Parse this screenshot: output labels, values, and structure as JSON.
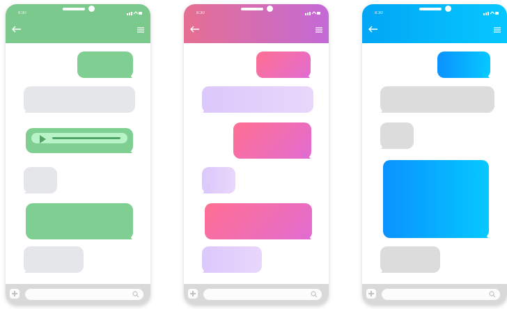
{
  "phones": [
    {
      "id": "green",
      "status_time": "8:30",
      "icons": [
        "back-arrow-icon",
        "menu-icon",
        "plus-icon",
        "search-icon"
      ]
    },
    {
      "id": "pink",
      "status_time": "8:30",
      "icons": [
        "back-arrow-icon",
        "menu-icon",
        "plus-icon",
        "search-icon"
      ]
    },
    {
      "id": "blue",
      "status_time": "8:30",
      "icons": [
        "back-arrow-icon",
        "menu-icon",
        "plus-icon",
        "search-icon"
      ]
    }
  ],
  "colors": {
    "green_header": "#7bc98d",
    "pink_header_start": "#e56f92",
    "pink_header_end": "#c36ad6",
    "blue_header_start": "#02a6f5",
    "blue_header_end": "#06c7ff",
    "bubble_gray": "#e4e6ea",
    "bubble_green": "#7fcf93",
    "bubble_lilac": "#dcc8fb",
    "bubble_pink_start": "#ff6f92",
    "bubble_pink_end": "#e16cd1",
    "bubble_blue_start": "#0a92ff",
    "bubble_blue_end": "#06c8ff",
    "bottom_bar": "#d9d9d9"
  }
}
